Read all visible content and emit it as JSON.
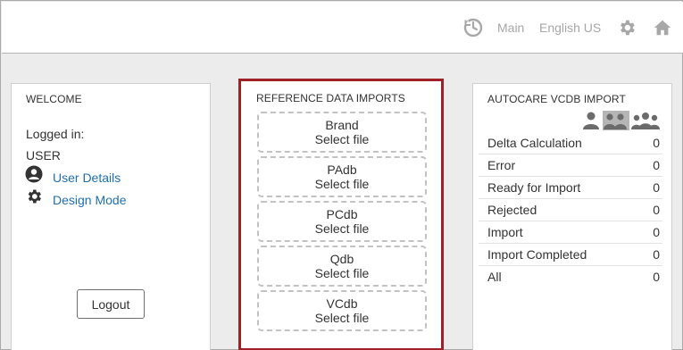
{
  "header": {
    "main_label": "Main",
    "language_label": "English US"
  },
  "welcome": {
    "title": "WELCOME",
    "logged_in_label": "Logged in:",
    "username": "USER",
    "user_details_label": "User Details",
    "design_mode_label": "Design Mode",
    "logout_label": "Logout"
  },
  "imports": {
    "title": "REFERENCE DATA IMPORTS",
    "items": [
      {
        "name": "Brand",
        "action": "Select file"
      },
      {
        "name": "PAdb",
        "action": "Select file"
      },
      {
        "name": "PCdb",
        "action": "Select file"
      },
      {
        "name": "Qdb",
        "action": "Select file"
      },
      {
        "name": "VCdb",
        "action": "Select file"
      }
    ],
    "highlight_color": "#a02028"
  },
  "autocare": {
    "title": "AUTOCARE VCDB IMPORT",
    "rows": [
      {
        "label": "Delta Calculation",
        "value": "0"
      },
      {
        "label": "Error",
        "value": "0"
      },
      {
        "label": "Ready for Import",
        "value": "0"
      },
      {
        "label": "Rejected",
        "value": "0"
      },
      {
        "label": "Import",
        "value": "0"
      },
      {
        "label": "Import Completed",
        "value": "0"
      },
      {
        "label": "All",
        "value": "0"
      }
    ]
  },
  "icons": {
    "header": [
      "history-icon",
      "gear-icon",
      "home-icon"
    ],
    "welcome": [
      "user-circle-icon",
      "gear-icon"
    ],
    "autocare": [
      "user-icon",
      "users-group-icon",
      "users-all-icon"
    ]
  },
  "colors": {
    "link": "#1f6fb2",
    "header_text": "#a7a7a7",
    "background": "#ececec"
  }
}
